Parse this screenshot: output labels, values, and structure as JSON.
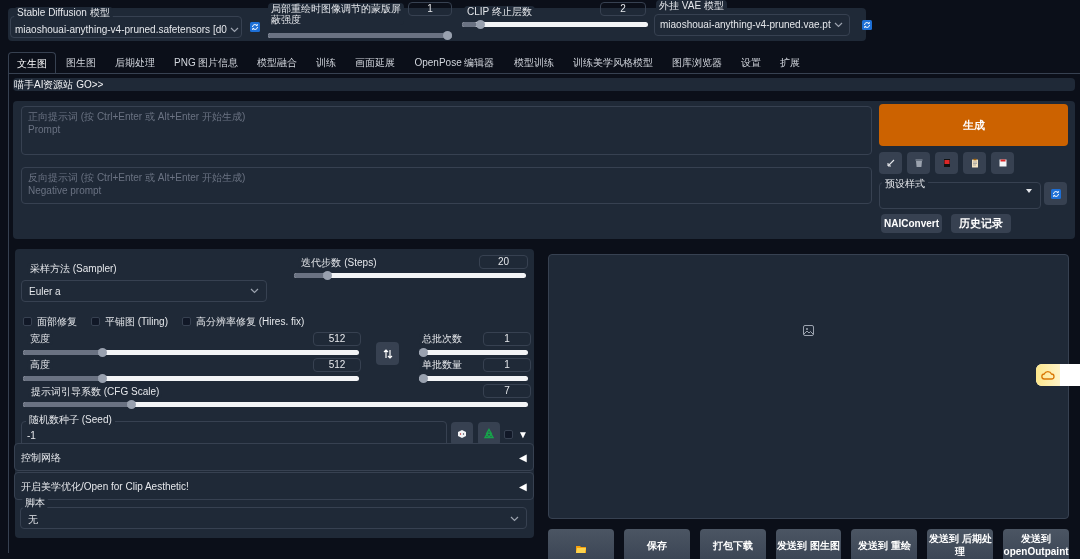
{
  "top_bar": {
    "model": {
      "label": "Stable Diffusion 模型",
      "value": "miaoshouai-anything-v4-pruned.safetensors [d0"
    },
    "inpaint_mask": {
      "label": "局部重绘时图像调节的蒙版屏蔽强度",
      "value": "1",
      "level": 1
    },
    "clip_skip": {
      "label": "CLIP 终止层数",
      "value": "2",
      "level": 0.08
    },
    "vae": {
      "label": "外挂 VAE 模型",
      "value": "miaoshouai-anything-v4-pruned.vae.pt"
    }
  },
  "tabs": [
    {
      "label": "文生图",
      "selected": true
    },
    {
      "label": "图生图",
      "selected": false
    },
    {
      "label": "后期处理",
      "selected": false
    },
    {
      "label": "PNG 图片信息",
      "selected": false
    },
    {
      "label": "模型融合",
      "selected": false
    },
    {
      "label": "训练",
      "selected": false
    },
    {
      "label": "画面延展",
      "selected": false
    },
    {
      "label": "OpenPose 编辑器",
      "selected": false
    },
    {
      "label": "模型训练",
      "selected": false
    },
    {
      "label": "训练美学风格模型",
      "selected": false
    },
    {
      "label": "图库浏览器",
      "selected": false
    },
    {
      "label": "设置",
      "selected": false
    },
    {
      "label": "扩展",
      "selected": false
    }
  ],
  "banner": "喵手AI资源站 GO>>",
  "prompt": {
    "placeholder": "正向提示词 (按 Ctrl+Enter 或 Alt+Enter 开始生成)\nPrompt"
  },
  "negative_prompt": {
    "placeholder": "反向提示词 (按 Ctrl+Enter 或 Alt+Enter 开始生成)\nNegative prompt"
  },
  "generate_button": "生成",
  "styles": {
    "label": "预设样式"
  },
  "extra_buttons": [
    "NAIConvert",
    "历史记录"
  ],
  "sampler": {
    "label": "采样方法 (Sampler)",
    "value": "Euler a"
  },
  "steps": {
    "label": "迭代步数 (Steps)",
    "value": "20",
    "level": 0.13
  },
  "checkboxes": [
    {
      "label": "面部修复",
      "checked": false
    },
    {
      "label": "平铺图 (Tiling)",
      "checked": false
    },
    {
      "label": "高分辨率修复 (Hires. fix)",
      "checked": false
    }
  ],
  "width": {
    "label": "宽度",
    "value": "512",
    "level": 0.23
  },
  "height": {
    "label": "高度",
    "value": "512",
    "level": 0.23
  },
  "batch_count": {
    "label": "总批次数",
    "value": "1",
    "level": 0
  },
  "batch_size": {
    "label": "单批数量",
    "value": "1",
    "level": 0
  },
  "cfg_scale": {
    "label": "提示词引导系数 (CFG Scale)",
    "value": "7",
    "level": 0.21
  },
  "seed": {
    "label": "随机数种子 (Seed)",
    "value": "-1",
    "extra_checked": false,
    "expand_arrow": "▼"
  },
  "accordions": [
    {
      "label": "控制网络",
      "arrow": "◀"
    },
    {
      "label": "开启美学优化/Open for Clip Aesthetic!",
      "arrow": "◀"
    }
  ],
  "script": {
    "label": "脚本",
    "value": "无"
  },
  "output_buttons": [
    "保存",
    "打包下载",
    "发送到 图生图",
    "发送到 重绘",
    "发送到 后期处理",
    "发送到 openOutpaint"
  ]
}
